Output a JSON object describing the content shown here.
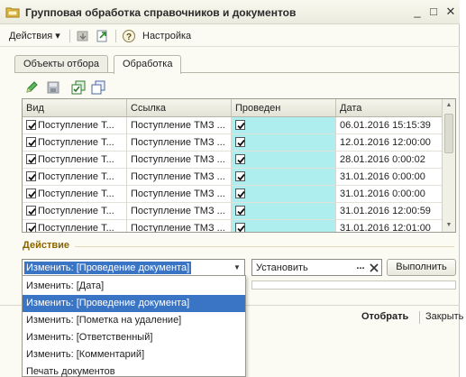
{
  "window": {
    "title": "Групповая обработка справочников и документов",
    "controls": [
      "_",
      "□",
      "✕"
    ]
  },
  "toolbar": {
    "actions_label": "Действия ▾",
    "settings_label": "Настройка"
  },
  "tabs": [
    {
      "label": "Объекты отбора",
      "active": false
    },
    {
      "label": "Обработка",
      "active": true
    }
  ],
  "grid": {
    "columns": [
      "Вид",
      "Ссылка",
      "Проведен",
      "Дата"
    ],
    "rows": [
      {
        "vid": "Поступление Т...",
        "link": "Поступление ТМЗ ...",
        "posted": true,
        "date": "06.01.2016 15:15:39"
      },
      {
        "vid": "Поступление Т...",
        "link": "Поступление ТМЗ ...",
        "posted": true,
        "date": "12.01.2016 12:00:00"
      },
      {
        "vid": "Поступление Т...",
        "link": "Поступление ТМЗ ...",
        "posted": true,
        "date": "28.01.2016 0:00:02"
      },
      {
        "vid": "Поступление Т...",
        "link": "Поступление ТМЗ ...",
        "posted": true,
        "date": "31.01.2016 0:00:00"
      },
      {
        "vid": "Поступление Т...",
        "link": "Поступление ТМЗ ...",
        "posted": true,
        "date": "31.01.2016 0:00:00"
      },
      {
        "vid": "Поступление Т...",
        "link": "Поступление ТМЗ ...",
        "posted": true,
        "date": "31.01.2016 12:00:59"
      },
      {
        "vid": "Поступление Т...",
        "link": "Поступление ТМЗ ...",
        "posted": true,
        "date": "31.01.2016 12:01:00"
      }
    ]
  },
  "action": {
    "label": "Действие",
    "combo_value": "Изменить: [Проведение документа]",
    "set_value": "Установить",
    "set_dots": "...",
    "run_label": "Выполнить"
  },
  "dropdown": {
    "items": [
      "Изменить: [Дата]",
      "Изменить: [Проведение документа]",
      "Изменить: [Пометка на удаление]",
      "Изменить: [Ответственный]",
      "Изменить: [Комментарий]",
      "Печать документов"
    ],
    "selected_index": 1
  },
  "footer": {
    "select_label": "Отобрать",
    "close_label": "Закрыть"
  },
  "colors": {
    "accent": "#3a74c4",
    "posted_cell": "#aeeeee",
    "section_label": "#8a6500"
  }
}
